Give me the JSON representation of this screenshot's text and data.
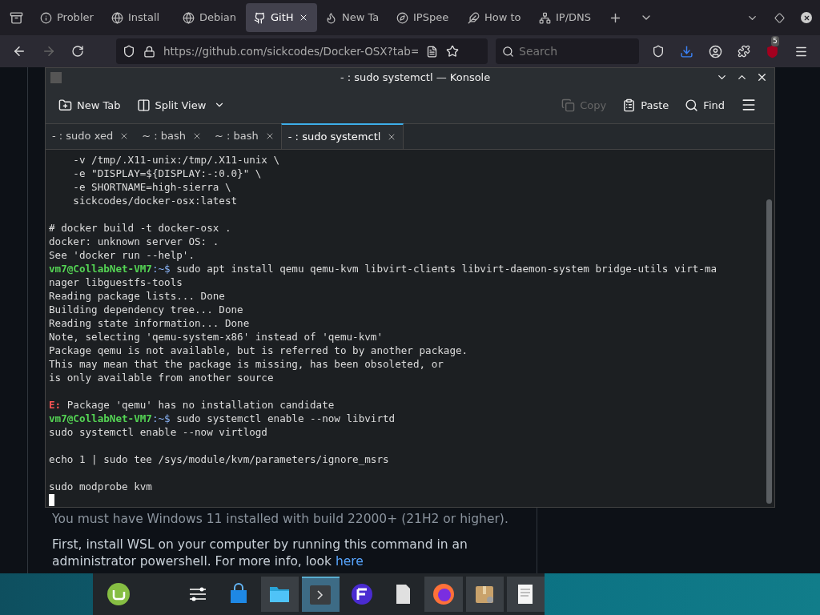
{
  "browser": {
    "tabs": [
      {
        "label": "Probler",
        "selected": false
      },
      {
        "label": "Install",
        "selected": false
      },
      {
        "label": "Debian",
        "selected": false
      },
      {
        "label": "GitH",
        "selected": true
      },
      {
        "label": "New Ta",
        "selected": false
      },
      {
        "label": "IPSpee",
        "selected": false
      },
      {
        "label": "How to",
        "selected": false
      },
      {
        "label": "IP/DNS",
        "selected": false
      }
    ],
    "url": "https://github.com/sickcodes/Docker-OSX?tab=",
    "search": {
      "placeholder": "Search"
    },
    "extension_badge": "5"
  },
  "page": {
    "paragraphs": [
      "You must have Windows 11 installed with build 22000+ (21H2 or higher).",
      "First, install WSL on your computer by running this command in an"
    ],
    "cut_line": "administrator powershell. For more info, look",
    "cut_link": "here"
  },
  "konsole": {
    "title": "- : sudo systemctl — Konsole",
    "toolbar": [
      {
        "label": "New Tab",
        "disabled": false
      },
      {
        "label": "Split View",
        "disabled": false
      },
      {
        "label": "Copy",
        "disabled": true
      },
      {
        "label": "Paste",
        "disabled": false
      },
      {
        "label": "Find",
        "disabled": false
      }
    ],
    "tabs": [
      {
        "label": "- : sudo xed",
        "selected": false
      },
      {
        "label": "~ : bash",
        "selected": false
      },
      {
        "label": "~ : bash",
        "selected": false
      },
      {
        "label": "- : sudo systemctl",
        "selected": true
      }
    ],
    "lines": [
      {
        "kind": "plain",
        "text": "    -v /tmp/.X11-unix:/tmp/.X11-unix \\"
      },
      {
        "kind": "plain",
        "text": "    -e \"DISPLAY=${DISPLAY:-:0.0}\" \\"
      },
      {
        "kind": "plain",
        "text": "    -e SHORTNAME=high-sierra \\"
      },
      {
        "kind": "plain",
        "text": "    sickcodes/docker-osx:latest"
      },
      {
        "kind": "blank"
      },
      {
        "kind": "plain",
        "text": "# docker build -t docker-osx ."
      },
      {
        "kind": "plain",
        "text": "docker: unknown server OS: ."
      },
      {
        "kind": "plain",
        "text": "See 'docker run --help'."
      },
      {
        "kind": "prompt",
        "prompt": "vm7@CollabNet-VM7",
        "path": ":~$",
        "text": " sudo apt install qemu qemu-kvm libvirt-clients libvirt-daemon-system bridge-utils virt-ma"
      },
      {
        "kind": "plain",
        "text": "nager libguestfs-tools"
      },
      {
        "kind": "plain",
        "text": "Reading package lists... Done"
      },
      {
        "kind": "plain",
        "text": "Building dependency tree... Done"
      },
      {
        "kind": "plain",
        "text": "Reading state information... Done"
      },
      {
        "kind": "plain",
        "text": "Note, selecting 'qemu-system-x86' instead of 'qemu-kvm'"
      },
      {
        "kind": "plain",
        "text": "Package qemu is not available, but is referred to by another package."
      },
      {
        "kind": "plain",
        "text": "This may mean that the package is missing, has been obsoleted, or"
      },
      {
        "kind": "plain",
        "text": "is only available from another source"
      },
      {
        "kind": "blank"
      },
      {
        "kind": "error",
        "prefix": "E:",
        "text": " Package 'qemu' has no installation candidate"
      },
      {
        "kind": "prompt",
        "prompt": "vm7@CollabNet-VM7",
        "path": ":~$",
        "text": " sudo systemctl enable --now libvirtd"
      },
      {
        "kind": "plain",
        "text": "sudo systemctl enable --now virtlogd"
      },
      {
        "kind": "blank"
      },
      {
        "kind": "plain",
        "text": "echo 1 | sudo tee /sys/module/kvm/parameters/ignore_msrs"
      },
      {
        "kind": "blank"
      },
      {
        "kind": "plain",
        "text": "sudo modprobe kvm"
      },
      {
        "kind": "cursor"
      }
    ]
  },
  "taskbar": {
    "apps": [
      {
        "running": false,
        "selected": false
      },
      {
        "running": false,
        "selected": false
      },
      {
        "running": false,
        "selected": false
      },
      {
        "running": true,
        "selected": false
      },
      {
        "running": true,
        "selected": true
      },
      {
        "running": false,
        "selected": false
      },
      {
        "running": false,
        "selected": false
      },
      {
        "running": true,
        "selected": false
      },
      {
        "running": true,
        "selected": false
      },
      {
        "running": true,
        "selected": false
      }
    ]
  }
}
